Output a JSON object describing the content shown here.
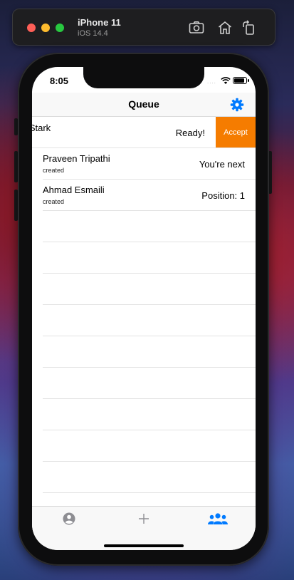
{
  "simulator": {
    "device_name": "iPhone 11",
    "os_version": "iOS 14.4",
    "icons": [
      "screenshot-icon",
      "home-icon",
      "rotate-icon"
    ]
  },
  "status_bar": {
    "time": "8:05",
    "signal": "....",
    "icons": [
      "wifi-icon",
      "battery-icon"
    ]
  },
  "nav": {
    "title": "Queue",
    "settings_icon": "gear-icon",
    "accent_color": "#007aff"
  },
  "queue": {
    "rows": [
      {
        "name": "e Stark",
        "subtitle": "",
        "status": "Ready!",
        "action_label": "Accept",
        "action_color": "#f57c00"
      },
      {
        "name": "Praveen Tripathi",
        "subtitle": "created",
        "status": "You're next"
      },
      {
        "name": "Ahmad Esmaili",
        "subtitle": "created",
        "status": "Position: 1"
      }
    ]
  },
  "tab_bar": {
    "tabs": [
      {
        "icon": "person-circle-icon",
        "selected": false
      },
      {
        "icon": "plus-icon",
        "selected": false
      },
      {
        "icon": "people-icon",
        "selected": true
      }
    ]
  }
}
